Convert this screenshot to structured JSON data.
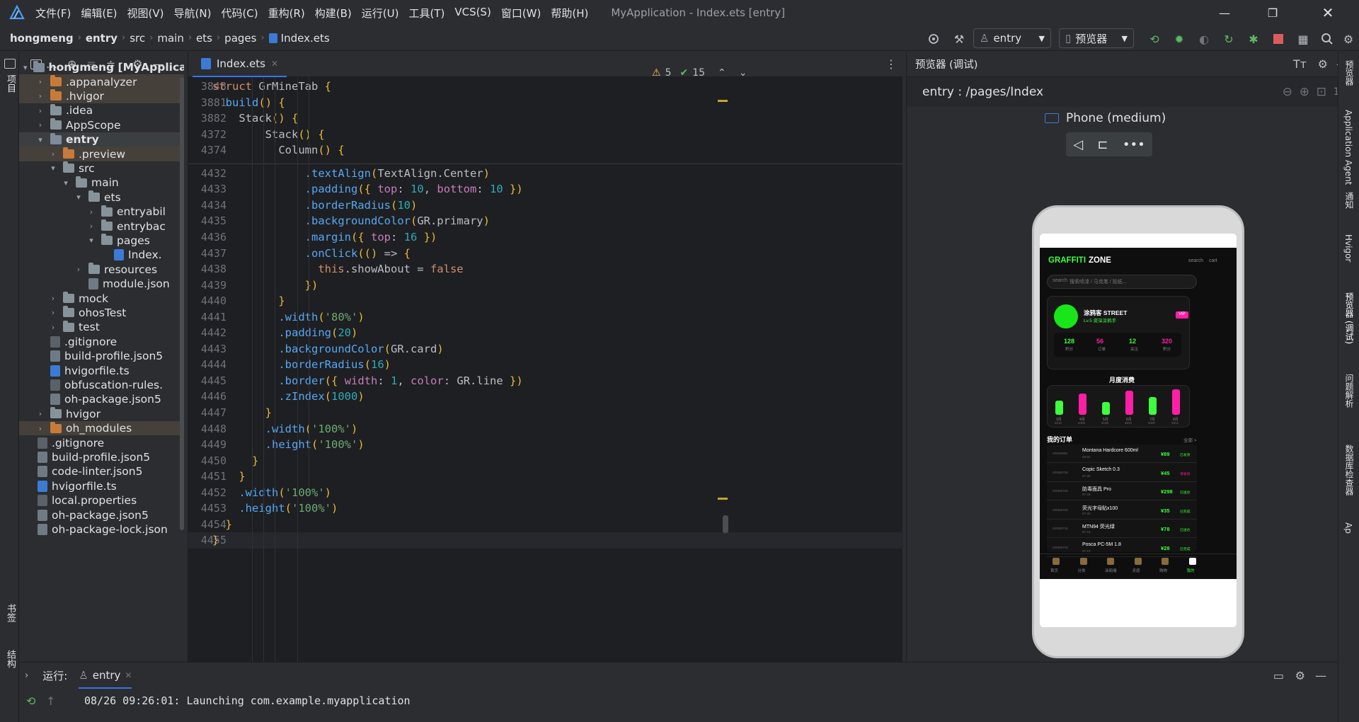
{
  "titlebar": {
    "menus": [
      "文件(F)",
      "编辑(E)",
      "视图(V)",
      "导航(N)",
      "代码(C)",
      "重构(R)",
      "构建(B)",
      "运行(U)",
      "工具(T)",
      "VCS(S)",
      "窗口(W)",
      "帮助(H)"
    ],
    "window_title": "MyApplication - Index.ets [entry]"
  },
  "breadcrumb": [
    "hongmeng",
    "entry",
    "src",
    "main",
    "ets",
    "pages",
    "Index.ets"
  ],
  "toolbar": {
    "module_combo": "entry",
    "device_combo": "预览器"
  },
  "left_strip": {
    "project": "项目",
    "bookmarks": "书签",
    "structure": "结构"
  },
  "project_tree": [
    {
      "label": "hongmeng [MyApplicati",
      "kind": "module",
      "arrow": "▾"
    },
    {
      "label": ".appanalyzer",
      "kind": "folder-orange",
      "arrow": "›"
    },
    {
      "label": ".hvigor",
      "kind": "folder-orange",
      "arrow": "›"
    },
    {
      "label": ".idea",
      "kind": "folder",
      "arrow": "›"
    },
    {
      "label": "AppScope",
      "kind": "folder",
      "arrow": "›"
    },
    {
      "label": "entry",
      "kind": "module",
      "arrow": "▾"
    },
    {
      "label": ".preview",
      "kind": "folder-orange",
      "arrow": "›"
    },
    {
      "label": "src",
      "kind": "folder",
      "arrow": "▾"
    },
    {
      "label": "main",
      "kind": "folder",
      "arrow": "▾"
    },
    {
      "label": "ets",
      "kind": "folder",
      "arrow": "▾"
    },
    {
      "label": "entryabil",
      "kind": "folder",
      "arrow": "›"
    },
    {
      "label": "entrybac",
      "kind": "folder",
      "arrow": "›"
    },
    {
      "label": "pages",
      "kind": "folder",
      "arrow": "▾"
    },
    {
      "label": "Index.",
      "kind": "ets",
      "arrow": ""
    },
    {
      "label": "resources",
      "kind": "folder",
      "arrow": "›"
    },
    {
      "label": "module.json",
      "kind": "json",
      "arrow": ""
    },
    {
      "label": "mock",
      "kind": "folder",
      "arrow": "›"
    },
    {
      "label": "ohosTest",
      "kind": "folder",
      "arrow": "›"
    },
    {
      "label": "test",
      "kind": "folder",
      "arrow": "›"
    },
    {
      "label": ".gitignore",
      "kind": "file",
      "arrow": ""
    },
    {
      "label": "build-profile.json5",
      "kind": "json",
      "arrow": ""
    },
    {
      "label": "hvigorfile.ts",
      "kind": "ts",
      "arrow": ""
    },
    {
      "label": "obfuscation-rules.",
      "kind": "file",
      "arrow": ""
    },
    {
      "label": "oh-package.json5",
      "kind": "json",
      "arrow": ""
    },
    {
      "label": "hvigor",
      "kind": "folder",
      "arrow": "›"
    },
    {
      "label": "oh_modules",
      "kind": "folder-orange",
      "arrow": "›"
    },
    {
      "label": ".gitignore",
      "kind": "file",
      "arrow": ""
    },
    {
      "label": "build-profile.json5",
      "kind": "json",
      "arrow": ""
    },
    {
      "label": "code-linter.json5",
      "kind": "json",
      "arrow": ""
    },
    {
      "label": "hvigorfile.ts",
      "kind": "ts",
      "arrow": ""
    },
    {
      "label": "local.properties",
      "kind": "file",
      "arrow": ""
    },
    {
      "label": "oh-package.json5",
      "kind": "json",
      "arrow": ""
    },
    {
      "label": "oh-package-lock.json",
      "kind": "json",
      "arrow": ""
    }
  ],
  "editor": {
    "tab": "Index.ets",
    "warnings": "5",
    "weak_warnings": "15",
    "sticky_lines": [
      {
        "num": "3848",
        "code": "struct GrMineTab {"
      },
      {
        "num": "3881",
        "code": "  build() {"
      },
      {
        "num": "3882",
        "code": "    Stack() {"
      },
      {
        "num": "4372",
        "code": "        Stack() {"
      },
      {
        "num": "4374",
        "code": "          Column() {"
      }
    ],
    "lines": [
      {
        "num": "4432",
        "code": "              .textAlign(TextAlign.Center)"
      },
      {
        "num": "4433",
        "code": "              .padding({ top: 10, bottom: 10 })"
      },
      {
        "num": "4434",
        "code": "              .borderRadius(10)"
      },
      {
        "num": "4435",
        "code": "              .backgroundColor(GR.primary)"
      },
      {
        "num": "4436",
        "code": "              .margin({ top: 16 })"
      },
      {
        "num": "4437",
        "code": "              .onClick(() => {"
      },
      {
        "num": "4438",
        "code": "                this.showAbout = false"
      },
      {
        "num": "4439",
        "code": "              })"
      },
      {
        "num": "4440",
        "code": "          }"
      },
      {
        "num": "4441",
        "code": "          .width('80%')"
      },
      {
        "num": "4442",
        "code": "          .padding(20)"
      },
      {
        "num": "4443",
        "code": "          .backgroundColor(GR.card)"
      },
      {
        "num": "4444",
        "code": "          .borderRadius(16)"
      },
      {
        "num": "4445",
        "code": "          .border({ width: 1, color: GR.line })"
      },
      {
        "num": "4446",
        "code": "          .zIndex(1000)"
      },
      {
        "num": "4447",
        "code": "        }"
      },
      {
        "num": "4448",
        "code": "        .width('100%')"
      },
      {
        "num": "4449",
        "code": "        .height('100%')"
      },
      {
        "num": "4450",
        "code": "      }"
      },
      {
        "num": "4451",
        "code": "    }"
      },
      {
        "num": "4452",
        "code": "    .width('100%')"
      },
      {
        "num": "4453",
        "code": "    .height('100%')"
      },
      {
        "num": "4454",
        "code": "  }"
      },
      {
        "num": "4455",
        "code": "}"
      }
    ]
  },
  "preview": {
    "panel_title": "预览器 (调试)",
    "route": "entry : /pages/Index",
    "device": "Phone (medium)",
    "app": {
      "brand_a": "GRAFFITI",
      "brand_b": " ZONE",
      "nav_search": "search",
      "nav_cart": "cart",
      "search_prefix": "search",
      "search_placeholder": "搜索喷漆 / 马克笔 / 贴纸...",
      "user_name": "涂鸦客 STREET",
      "user_level": "Lv.5 资深涂鸦手",
      "vip": "VIP",
      "stats": [
        {
          "value": "128",
          "label": "积分",
          "color": "#3dff3d"
        },
        {
          "value": "56",
          "label": "订单",
          "color": "#ff1fa6"
        },
        {
          "value": "12",
          "label": "关注",
          "color": "#3dff3d"
        },
        {
          "value": "320",
          "label": "积分",
          "color": "#ff1fa6"
        }
      ],
      "monthly_title": "月度消费",
      "bars": [
        {
          "label": "3月",
          "sub": "¥210",
          "value": 0.55,
          "color": "#3dff3d"
        },
        {
          "label": "4月",
          "sub": "¥458",
          "value": 0.82,
          "color": "#ff1fa6"
        },
        {
          "label": "5月",
          "sub": "¥198",
          "value": 0.5,
          "color": "#3dff3d"
        },
        {
          "label": "6月",
          "sub": "¥620",
          "value": 0.95,
          "color": "#ff1fa6"
        },
        {
          "label": "7月",
          "sub": "¥380",
          "value": 0.7,
          "color": "#3dff3d"
        },
        {
          "label": "8月",
          "sub": "¥512",
          "value": 1.0,
          "color": "#ff1fa6"
        }
      ],
      "orders_title": "我的订单",
      "orders_all": "全部 >",
      "orders": [
        {
          "id": "GR260801",
          "name": "Montana Hardcore 600ml",
          "date": "08-01",
          "price": "¥89",
          "status": "已发货",
          "status_color": "#3dff3d"
        },
        {
          "id": "GR260726",
          "name": "Copic Sketch 0.3",
          "date": "07-26",
          "price": "¥45",
          "status": "待发货",
          "status_color": "#ff1fa6"
        },
        {
          "id": "GR260725",
          "name": "防毒面具 Pro",
          "date": "07-25",
          "price": "¥298",
          "status": "已送达",
          "status_color": "#3dff3d"
        },
        {
          "id": "GR260720",
          "name": "荧光字母贴x100",
          "date": "07-20",
          "price": "¥35",
          "status": "已完成",
          "status_color": "#3dff3d"
        },
        {
          "id": "GR260715",
          "name": "MTN94 荧光绿",
          "date": "07-15",
          "price": "¥78",
          "status": "已送达",
          "status_color": "#3dff3d"
        },
        {
          "id": "GR260710",
          "name": "Posca PC-5M 1.8",
          "date": "07-10",
          "price": "¥28",
          "status": "已完成",
          "status_color": "#3dff3d"
        }
      ],
      "tabs": [
        "首页",
        "分类",
        "涂鸦墙",
        "灵感",
        "购物",
        "我的"
      ]
    }
  },
  "right_strip": [
    "预览器",
    "Application Agent",
    "通知",
    "Hvigor",
    "预览器 (调试)",
    "问题解析",
    "数据库检查器",
    "Ap"
  ],
  "run": {
    "label": "运行:",
    "config": "entry",
    "console_line": "08/26 09:26:01: Launching com.example.myapplication"
  },
  "colors": {
    "accent_green": "#3dff3d",
    "accent_pink": "#ff1fa6",
    "ide_bg": "#2b2d30",
    "editor_bg": "#1e1f22"
  }
}
